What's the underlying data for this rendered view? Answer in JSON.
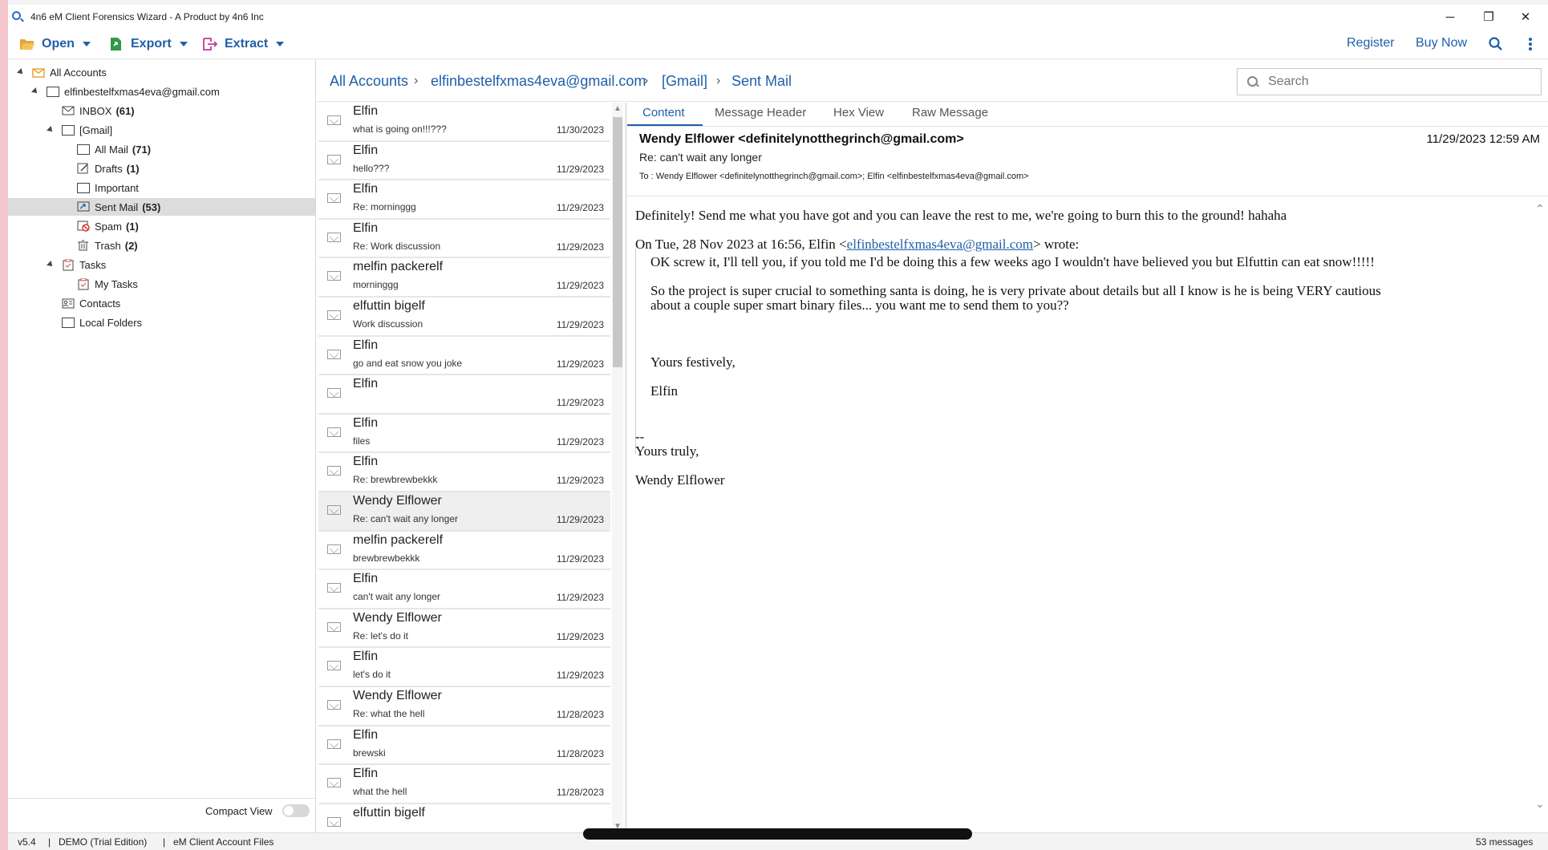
{
  "window": {
    "title": "4n6 eM Client Forensics Wizard - A Product by 4n6 Inc",
    "controls": {
      "minimize": "─",
      "restore": "❐",
      "close": "✕"
    }
  },
  "toolbar": {
    "open_label": "Open",
    "export_label": "Export",
    "extract_label": "Extract",
    "register_label": "Register",
    "buy_now_label": "Buy Now"
  },
  "sidebar": {
    "root": "All Accounts",
    "account": "elfinbestelfxmas4eva@gmail.com",
    "inbox": {
      "label": "INBOX",
      "count": "(61)"
    },
    "gmail": "[Gmail]",
    "all_mail": {
      "label": "All Mail",
      "count": "(71)"
    },
    "drafts": {
      "label": "Drafts",
      "count": "(1)"
    },
    "important": "Important",
    "sent_mail": {
      "label": "Sent Mail",
      "count": "(53)"
    },
    "spam": {
      "label": "Spam",
      "count": "(1)"
    },
    "trash": {
      "label": "Trash",
      "count": "(2)"
    },
    "tasks": "Tasks",
    "my_tasks": "My Tasks",
    "contacts": "Contacts",
    "local_folders": "Local Folders",
    "compact_view": "Compact View"
  },
  "breadcrumb": {
    "all_accounts": "All Accounts",
    "account": "elfinbestelfxmas4eva@gmail.com",
    "gmail": "[Gmail]",
    "sent_mail": "Sent Mail",
    "separator": "›"
  },
  "search": {
    "placeholder": "Search"
  },
  "messages": [
    {
      "from": "Elfin",
      "subject": "what is going on!!!???",
      "date": "11/30/2023"
    },
    {
      "from": "Elfin",
      "subject": "hello???",
      "date": "11/29/2023"
    },
    {
      "from": "Elfin",
      "subject": "Re: morninggg",
      "date": "11/29/2023"
    },
    {
      "from": "Elfin",
      "subject": "Re: Work discussion",
      "date": "11/29/2023"
    },
    {
      "from": "melfin packerelf",
      "subject": "morninggg",
      "date": "11/29/2023"
    },
    {
      "from": "elfuttin bigelf",
      "subject": "Work discussion",
      "date": "11/29/2023"
    },
    {
      "from": "Elfin",
      "subject": "go and eat snow you joke",
      "date": "11/29/2023"
    },
    {
      "from": "Elfin",
      "subject": "",
      "date": "11/29/2023"
    },
    {
      "from": "Elfin",
      "subject": "files",
      "date": "11/29/2023"
    },
    {
      "from": "Elfin",
      "subject": "Re: brewbrewbekkk",
      "date": "11/29/2023"
    },
    {
      "from": "Wendy Elflower",
      "subject": "Re: can't wait any longer",
      "date": "11/29/2023"
    },
    {
      "from": "melfin packerelf",
      "subject": "brewbrewbekkk",
      "date": "11/29/2023"
    },
    {
      "from": "Elfin",
      "subject": "can't wait any longer",
      "date": "11/29/2023"
    },
    {
      "from": "Wendy Elflower",
      "subject": "Re: let's do it",
      "date": "11/29/2023"
    },
    {
      "from": "Elfin",
      "subject": "let's do it",
      "date": "11/29/2023"
    },
    {
      "from": "Wendy Elflower",
      "subject": "Re: what the hell",
      "date": "11/28/2023"
    },
    {
      "from": "Elfin",
      "subject": "brewski",
      "date": "11/28/2023"
    },
    {
      "from": "Elfin",
      "subject": "what the hell",
      "date": "11/28/2023"
    },
    {
      "from": "elfuttin bigelf",
      "subject": "",
      "date": ""
    }
  ],
  "reader": {
    "tabs": {
      "content": "Content",
      "header": "Message Header",
      "hex": "Hex View",
      "raw": "Raw Message"
    },
    "from": "Wendy Elflower <definitelynotthegrinch@gmail.com>",
    "date": "11/29/2023 12:59 AM",
    "subject": "Re: can't wait any longer",
    "to": "To :   Wendy Elflower <definitelynotthegrinch@gmail.com>; Elfin <elfinbestelfxmas4eva@gmail.com>",
    "body": {
      "line1": "Definitely! Send me what you have got and you can leave the rest to me, we're going to burn this to the ground! hahaha",
      "wrote_prefix": "On Tue, 28 Nov 2023 at 16:56, Elfin <",
      "wrote_link": "elfinbestelfxmas4eva@gmail.com",
      "wrote_suffix": "> wrote:",
      "q1": "OK screw it, I'll tell you, if you told me I'd be doing this a few weeks ago I wouldn't have believed you but Elfuttin can eat snow!!!!!",
      "q2": "So the project is super crucial to something santa is doing, he is very private about details but all I know is he is being VERY cautious",
      "q3": "about a couple super smart binary files... you want me to send them to you??",
      "q4": "Yours festively,",
      "q5": "Elfin",
      "sig_dash": "--",
      "sig1": "Yours truly,",
      "sig2": "Wendy Elflower"
    }
  },
  "status": {
    "version": "v5.4",
    "edition": "DEMO (Trial Edition)",
    "source": "eM Client Account Files",
    "count": "53 messages",
    "separator": "|"
  },
  "colors": {
    "accent": "#1f5fa8",
    "selected_row": "#dcdcdc"
  }
}
